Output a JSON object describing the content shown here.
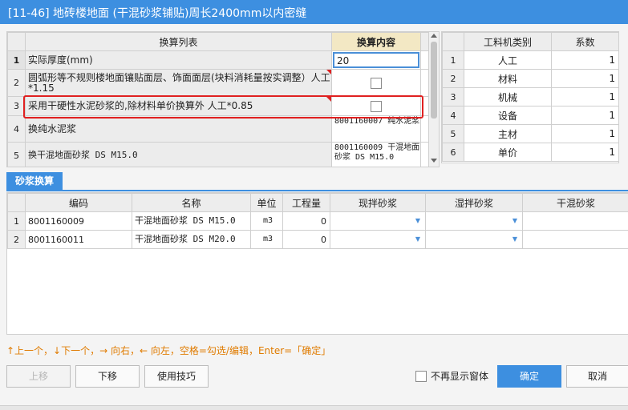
{
  "window": {
    "title": "[11-46] 地砖楼地面 (干混砂浆铺贴)周长2400mm以内密缝"
  },
  "conversion": {
    "headers": {
      "list": "换算列表",
      "content": "换算内容"
    },
    "rows": [
      {
        "num": "1",
        "label": "实际厚度(mm)",
        "value": "20"
      },
      {
        "num": "2",
        "label": "圆弧形等不规则楼地面镶贴面层、饰面面层(块料消耗量按实调整）人工*1.15"
      },
      {
        "num": "3",
        "label": "采用干硬性水泥砂浆的,除材料单价换算外 人工*0.85"
      },
      {
        "num": "4",
        "label": "换纯水泥浆",
        "value": "8001160007  纯水泥浆"
      },
      {
        "num": "5",
        "label": "换干混地面砂浆 DS M15.0",
        "value": "8001160009  干混地面砂浆 DS M15.0"
      }
    ]
  },
  "resource": {
    "headers": {
      "type": "工料机类别",
      "coef": "系数"
    },
    "rows": [
      {
        "num": "1",
        "type": "人工",
        "coef": "1"
      },
      {
        "num": "2",
        "type": "材料",
        "coef": "1"
      },
      {
        "num": "3",
        "type": "机械",
        "coef": "1"
      },
      {
        "num": "4",
        "type": "设备",
        "coef": "1"
      },
      {
        "num": "5",
        "type": "主材",
        "coef": "1"
      },
      {
        "num": "6",
        "type": "单价",
        "coef": "1"
      }
    ]
  },
  "mortar": {
    "tab": "砂浆换算",
    "headers": {
      "code": "编码",
      "name": "名称",
      "unit": "单位",
      "qty": "工程量",
      "site": "现拌砂浆",
      "wet": "湿拌砂浆",
      "dry": "干混砂浆"
    },
    "rows": [
      {
        "num": "1",
        "code": "8001160009",
        "name": "干混地面砂浆 DS M15.0",
        "unit": "m3",
        "qty": "0"
      },
      {
        "num": "2",
        "code": "8001160011",
        "name": "干混地面砂浆 DS M20.0",
        "unit": "m3",
        "qty": "0"
      }
    ]
  },
  "hint": "↑上一个，↓下一个，→ 向右，← 向左，空格=勾选/编辑，Enter=「确定」",
  "buttons": {
    "up": "上移",
    "down": "下移",
    "tips": "使用技巧",
    "ok": "确定",
    "cancel": "取消"
  },
  "no_show": "不再显示窗体",
  "colors": {
    "titlebar": "#3d8fe0",
    "highlight": "#e02020",
    "hint": "#e07b00",
    "primary": "#3d8fe0"
  }
}
